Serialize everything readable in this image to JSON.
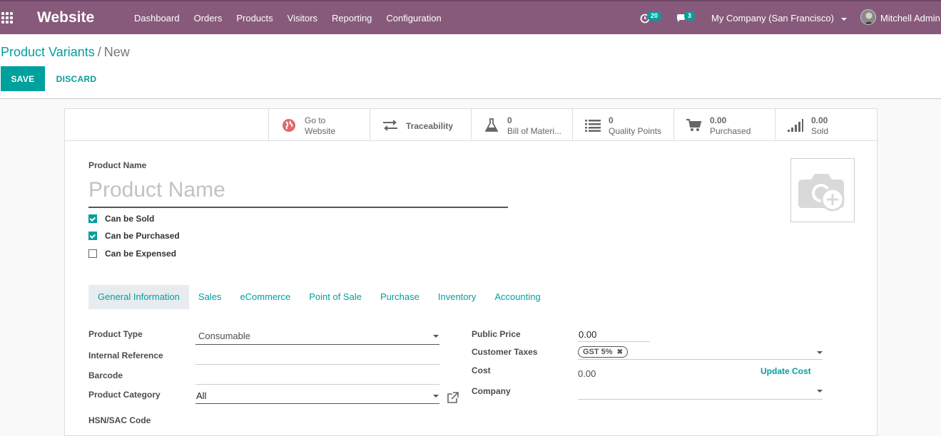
{
  "navbar": {
    "brand": "Website",
    "menu": [
      "Dashboard",
      "Orders",
      "Products",
      "Visitors",
      "Reporting",
      "Configuration"
    ],
    "activity_count": "20",
    "message_count": "3",
    "company": "My Company (San Francisco)",
    "user": "Mitchell Admin"
  },
  "breadcrumb": {
    "parent": "Product Variants",
    "separator": "/",
    "current": "New"
  },
  "actions": {
    "save": "SAVE",
    "discard": "DISCARD"
  },
  "smart_buttons": {
    "website": {
      "line1": "Go to",
      "line2": "Website"
    },
    "traceability": {
      "label": "Traceability"
    },
    "bom": {
      "value": "0",
      "label": "Bill of Materi..."
    },
    "quality": {
      "value": "0",
      "label": "Quality Points"
    },
    "purchased": {
      "value": "0.00",
      "label": "Purchased"
    },
    "sold": {
      "value": "0.00",
      "label": "Sold"
    }
  },
  "form": {
    "name_label": "Product Name",
    "name_placeholder": "Product Name",
    "can_be_sold": "Can be Sold",
    "can_be_purchased": "Can be Purchased",
    "can_be_expensed": "Can be Expensed"
  },
  "tabs": [
    "General Information",
    "Sales",
    "eCommerce",
    "Point of Sale",
    "Purchase",
    "Inventory",
    "Accounting"
  ],
  "general": {
    "product_type_label": "Product Type",
    "product_type_value": "Consumable",
    "internal_ref_label": "Internal Reference",
    "barcode_label": "Barcode",
    "category_label": "Product Category",
    "category_value": "All",
    "hsn_label": "HSN/SAC Code",
    "public_price_label": "Public Price",
    "public_price_value": "0.00",
    "customer_taxes_label": "Customer Taxes",
    "tax_tag": "GST 5%",
    "cost_label": "Cost",
    "cost_value": "0.00",
    "update_cost": "Update Cost",
    "company_label": "Company"
  }
}
